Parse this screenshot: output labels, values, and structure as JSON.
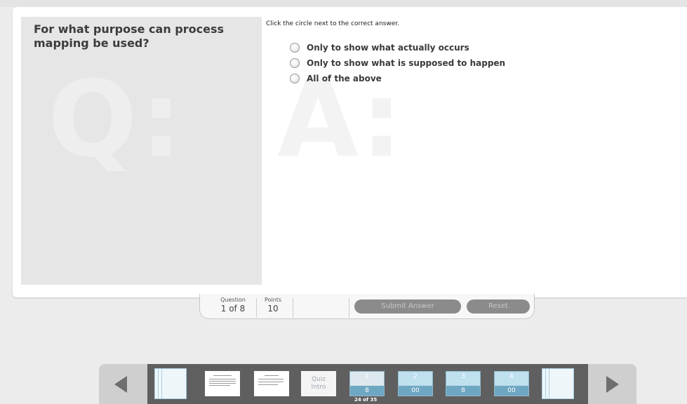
{
  "question": {
    "text": "For what purpose can process mapping be used?",
    "watermark": "Q:"
  },
  "answer": {
    "watermark": "A:",
    "instruction": "Click the circle next to the correct answer.",
    "options": [
      "Only to show what actually occurs",
      "Only to show what is supposed to happen",
      "All of the above"
    ]
  },
  "info_bar": {
    "question_label": "Question",
    "question_value": "1 of 8",
    "points_label": "Points",
    "points_value": "10",
    "submit_label": "Submit Answer",
    "reset_label": "Reset"
  },
  "nav": {
    "quiz_intro_line1": "Quiz",
    "quiz_intro_line2": "Intro",
    "questions": [
      {
        "num": "1",
        "strip": "8"
      },
      {
        "num": "2",
        "strip": "00"
      },
      {
        "num": "3",
        "strip": "8"
      },
      {
        "num": "4",
        "strip": "00"
      }
    ],
    "counter": "24 of 35"
  },
  "colors": {
    "accent": "#6ea7c2",
    "button": "#8b8b8b"
  }
}
